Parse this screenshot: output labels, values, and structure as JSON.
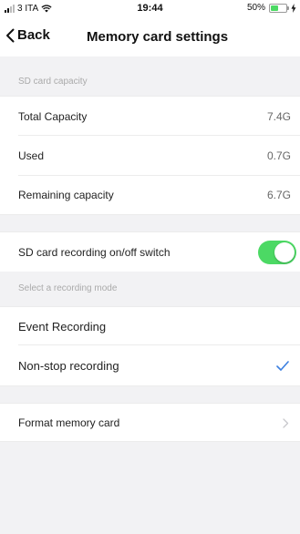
{
  "status_bar": {
    "carrier": "3 ITA",
    "time": "19:44",
    "battery": "50%",
    "battery_level": 0.5,
    "battery_color": "#4cd964",
    "icons": [
      "signal-icon",
      "wifi-icon",
      "battery-icon",
      "charging-bolt-icon"
    ]
  },
  "nav": {
    "back_label": "Back",
    "title": "Memory card settings"
  },
  "capacity_section": {
    "header": "SD card capacity",
    "rows": [
      {
        "label": "Total Capacity",
        "value": "7.4G"
      },
      {
        "label": "Used",
        "value": "0.7G"
      },
      {
        "label": "Remaining capacity",
        "value": "6.7G"
      }
    ]
  },
  "recording_switch": {
    "label": "SD card recording on/off switch",
    "on": true,
    "accent_color": "#4cd964"
  },
  "mode_section": {
    "header": "Select a recording mode",
    "options": [
      {
        "label": "Event Recording",
        "selected": false
      },
      {
        "label": "Non-stop recording",
        "selected": true
      }
    ],
    "check_color": "#3b7fe0"
  },
  "format": {
    "label": "Format memory card"
  }
}
